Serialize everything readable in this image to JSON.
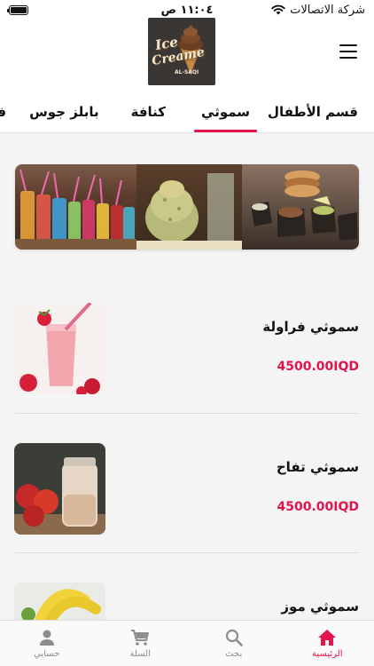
{
  "status_bar": {
    "carrier": "شركة الاتصالات",
    "time": "١١:٠٤ ص",
    "battery_level": 1.0
  },
  "logo": {
    "line1": "Ice",
    "line2": "Creame",
    "line3": "AL-SAQI"
  },
  "category_tabs": [
    {
      "label": "قسم الأطفال",
      "active": false
    },
    {
      "label": "سموثي",
      "active": true
    },
    {
      "label": "كنافة",
      "active": false
    },
    {
      "label": "بابلز جوس",
      "active": false
    },
    {
      "label": "فر",
      "active": false
    }
  ],
  "products": [
    {
      "name": "سموثي فراولة",
      "price": "4500.00IQD"
    },
    {
      "name": "سموثي تفاح",
      "price": "4500.00IQD"
    },
    {
      "name": "سموثي موز",
      "price": ""
    }
  ],
  "bottom_nav": [
    {
      "label": "الرئيسية",
      "icon": "home-icon",
      "active": true
    },
    {
      "label": "بحث",
      "icon": "search-icon",
      "active": false
    },
    {
      "label": "السلة",
      "icon": "cart-icon",
      "active": false
    },
    {
      "label": "حسابي",
      "icon": "user-icon",
      "active": false
    }
  ],
  "colors": {
    "accent": "#e0154c",
    "background": "#f4f4f4",
    "inactive": "#8e8e8e"
  }
}
